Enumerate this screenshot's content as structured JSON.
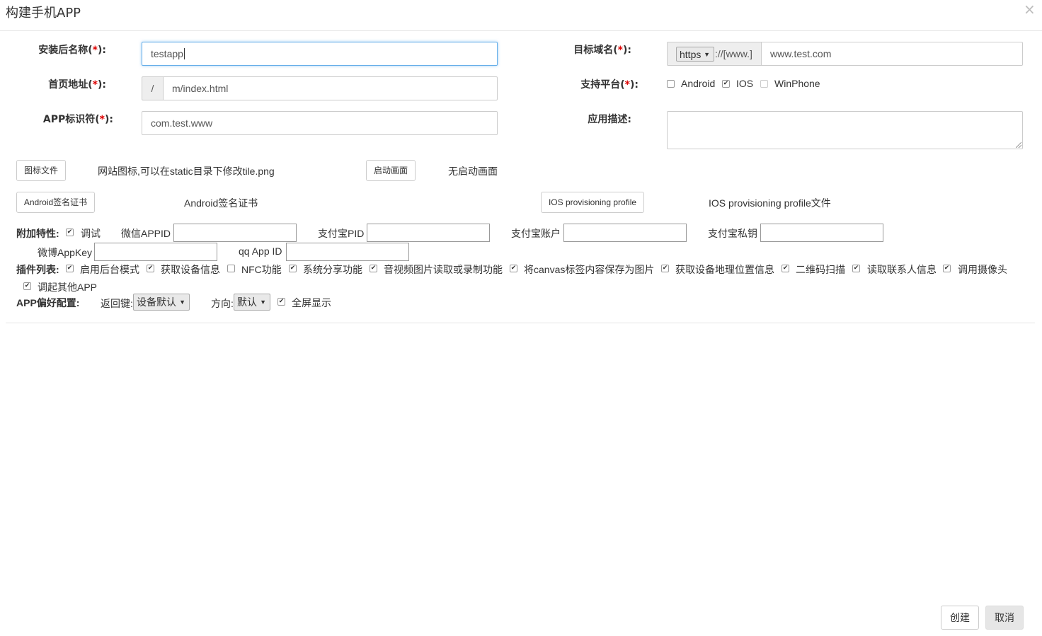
{
  "modal": {
    "title": "构建手机APP",
    "close": "×"
  },
  "form": {
    "install_name": {
      "label": "安装后名称",
      "value": "testapp"
    },
    "target_domain": {
      "label": "目标域名",
      "protocol": "https",
      "separator": "://[www.]",
      "value": "www.test.com"
    },
    "home_url": {
      "label": "首页地址",
      "prefix": "/",
      "value": "m/index.html"
    },
    "platforms": {
      "label": "支持平台",
      "options": [
        {
          "label": "Android",
          "checked": false
        },
        {
          "label": "IOS",
          "checked": true
        },
        {
          "label": "WinPhone",
          "checked": false
        }
      ]
    },
    "app_id": {
      "label": "APP标识符",
      "value": "com.test.www"
    },
    "description": {
      "label": "应用描述",
      "value": ""
    },
    "req_open": "(",
    "req_star": "*",
    "req_close": "):",
    "colon": ":"
  },
  "files": {
    "icon_button": "图标文件",
    "icon_text": "网站图标,可以在static目录下修改tile.png",
    "splash_button": "启动画面",
    "splash_text": "无启动画面",
    "android_cert_button": "Android签名证书",
    "android_cert_text": "Android签名证书",
    "ios_profile_button": "IOS provisioning profile",
    "ios_profile_text": "IOS provisioning profile文件"
  },
  "extras": {
    "label": "附加特性:",
    "debug": {
      "label": "调试",
      "checked": true
    },
    "wechat_appid": "微信APPID",
    "alipay_pid": "支付宝PID",
    "alipay_account": "支付宝账户",
    "alipay_key": "支付宝私钥",
    "weibo_appkey": "微博AppKey",
    "qq_appid": "qq App ID"
  },
  "plugins": {
    "label": "插件列表:",
    "items": [
      {
        "label": "启用后台模式",
        "checked": true
      },
      {
        "label": "获取设备信息",
        "checked": true
      },
      {
        "label": "NFC功能",
        "checked": false
      },
      {
        "label": "系统分享功能",
        "checked": true
      },
      {
        "label": "音视频图片读取或录制功能",
        "checked": true
      },
      {
        "label": "将canvas标签内容保存为图片",
        "checked": true
      },
      {
        "label": "获取设备地理位置信息",
        "checked": true
      },
      {
        "label": "二维码扫描",
        "checked": true
      },
      {
        "label": "读取联系人信息",
        "checked": true
      },
      {
        "label": "调用摄像头",
        "checked": true
      },
      {
        "label": "调起其他APP",
        "checked": true
      }
    ]
  },
  "prefs": {
    "label": "APP偏好配置:",
    "back_key_label": "返回键:",
    "back_key_value": "设备默认",
    "orientation_label": "方向:",
    "orientation_value": "默认",
    "fullscreen": {
      "label": "全屏显示",
      "checked": true
    }
  },
  "footer": {
    "create": "创建",
    "cancel": "取消"
  }
}
